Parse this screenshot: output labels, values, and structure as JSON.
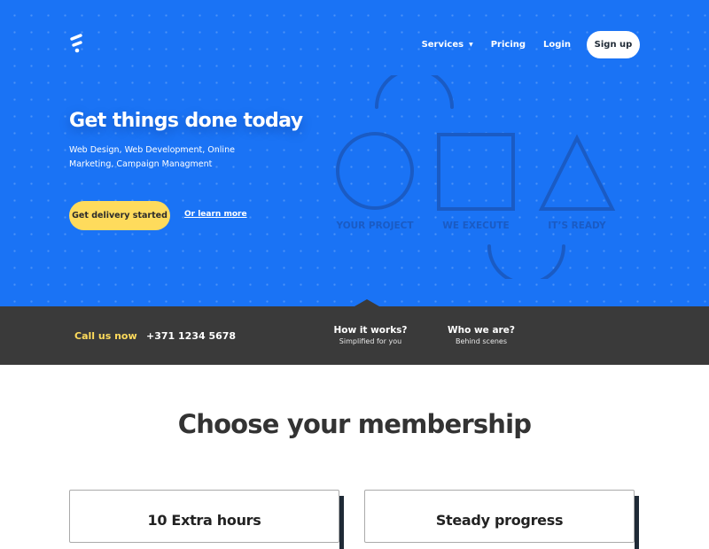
{
  "nav": {
    "logo": "brand-logo",
    "items": [
      {
        "label": "Services",
        "has_dropdown": true
      },
      {
        "label": "Pricing"
      },
      {
        "label": "Login"
      }
    ],
    "signup_label": "Sign up"
  },
  "hero": {
    "headline": "Get things done today",
    "subtitle": "Web Design, Web Development, Online Marketing, Campaign Managment",
    "cta_label": "Get delivery started",
    "secondary_link": "Or learn more",
    "steps": [
      {
        "shape": "circle",
        "label": "YOUR PROJECT"
      },
      {
        "shape": "square",
        "label": "WE EXECUTE"
      },
      {
        "shape": "triangle",
        "label": "IT’S READY"
      }
    ]
  },
  "contact_bar": {
    "call_label": "Call us now",
    "phone": "+371 1234 5678",
    "links": [
      {
        "title": "How it works?",
        "subtitle": "Simplified for you"
      },
      {
        "title": "Who we are?",
        "subtitle": "Behind scenes"
      }
    ]
  },
  "membership": {
    "title": "Choose your membership",
    "plans": [
      {
        "title": "10 Extra hours"
      },
      {
        "title": "Steady progress"
      }
    ]
  },
  "colors": {
    "primary_blue": "#1a73f5",
    "accent_yellow": "#fedb5c",
    "dark_bar": "#3a3a3a",
    "shape_blue": "#1a5bc4"
  }
}
